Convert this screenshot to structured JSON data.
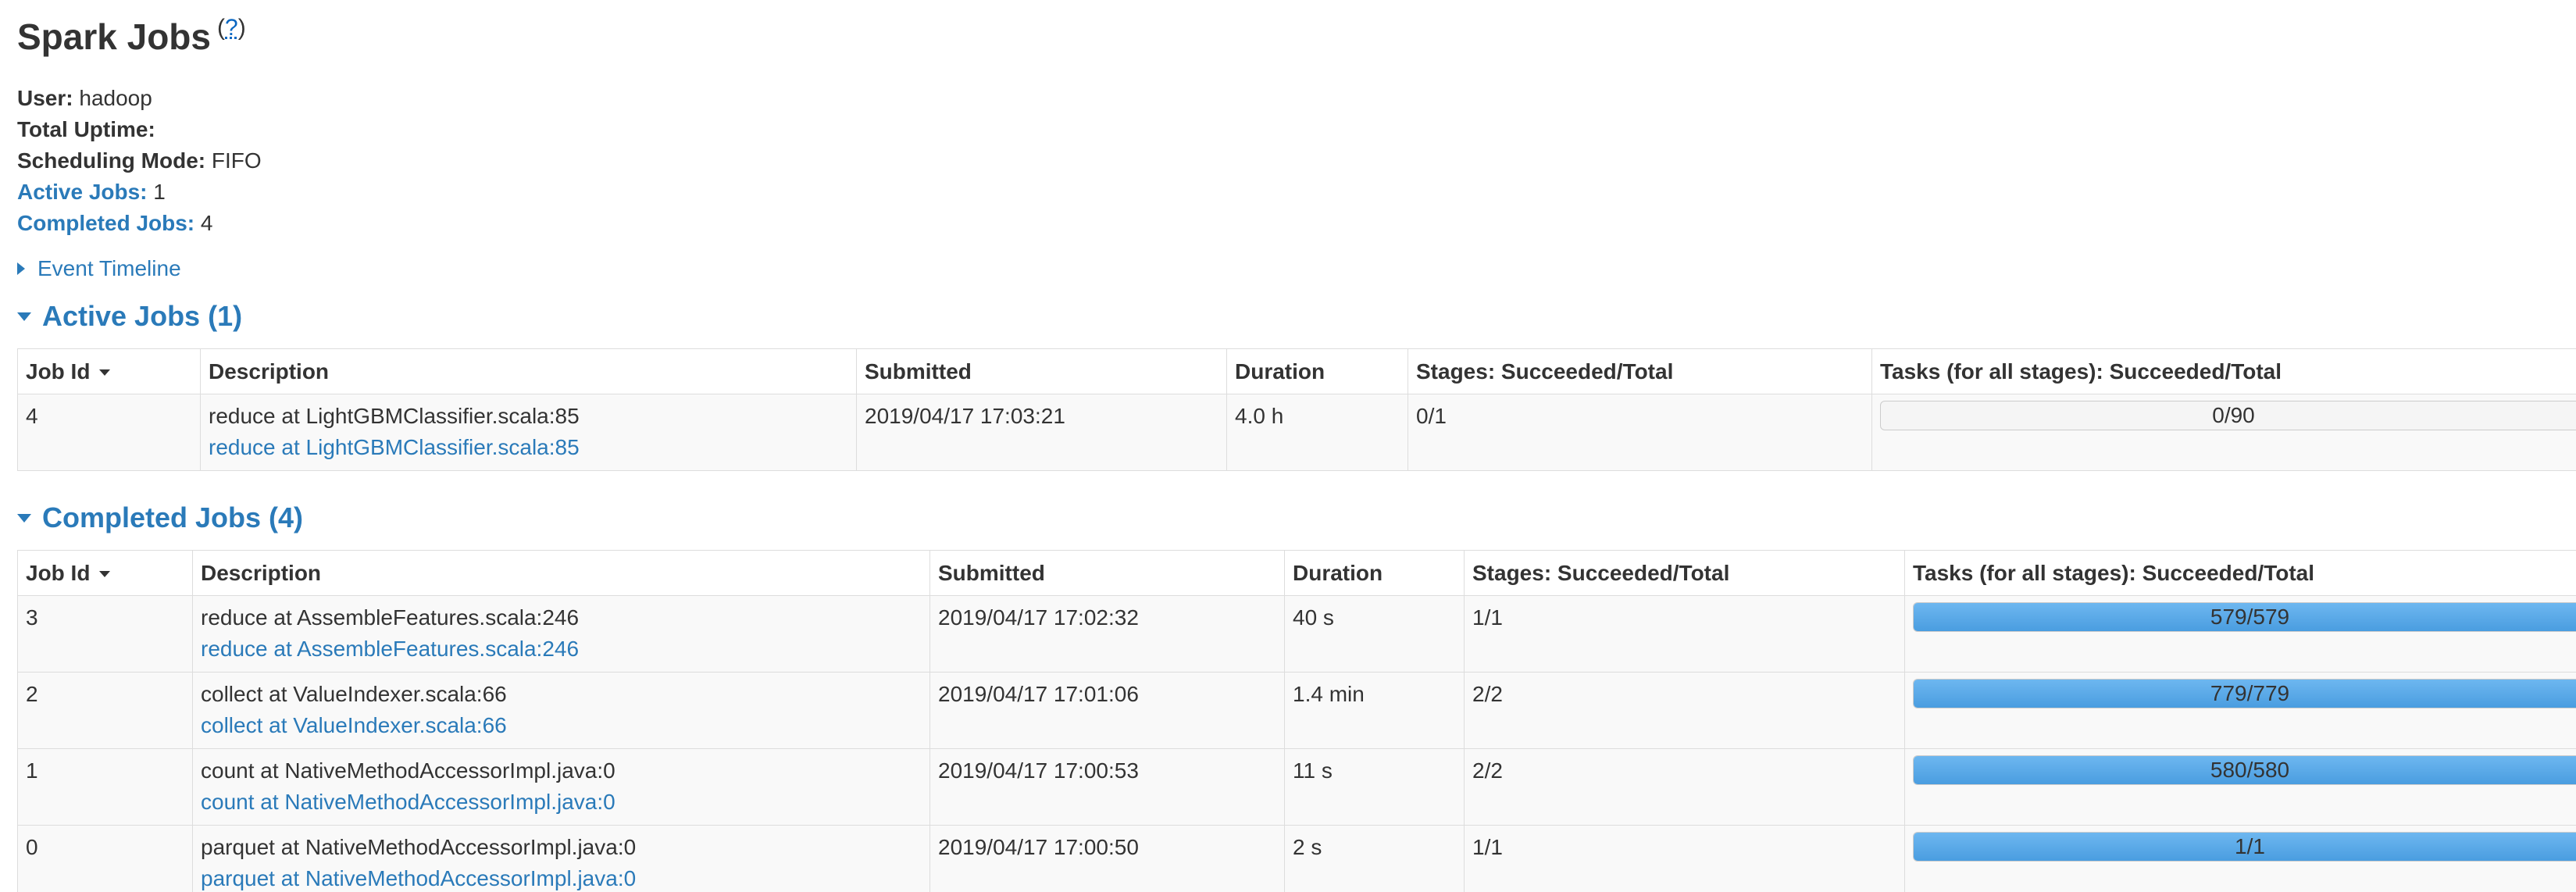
{
  "page": {
    "title": "Spark Jobs",
    "help_open": "(",
    "help_q": "?",
    "help_close": ")"
  },
  "summary": {
    "user_label": "User:",
    "user_value": "hadoop",
    "uptime_label": "Total Uptime:",
    "uptime_value": "",
    "scheduling_label": "Scheduling Mode:",
    "scheduling_value": "FIFO",
    "active_label": "Active Jobs:",
    "active_value": "1",
    "completed_label": "Completed Jobs:",
    "completed_value": "4"
  },
  "timeline": {
    "label": "Event Timeline"
  },
  "columns": {
    "job_id": "Job Id",
    "description": "Description",
    "submitted": "Submitted",
    "duration": "Duration",
    "stages": "Stages: Succeeded/Total",
    "tasks": "Tasks (for all stages): Succeeded/Total"
  },
  "active": {
    "header": "Active Jobs (1)",
    "rows": [
      {
        "id": "4",
        "desc": "reduce at LightGBMClassifier.scala:85",
        "desc_link": "reduce at LightGBMClassifier.scala:85",
        "submitted": "2019/04/17 17:03:21",
        "duration": "4.0 h",
        "stages": "0/1",
        "tasks": "0/90",
        "progress": 0
      }
    ]
  },
  "completed": {
    "header": "Completed Jobs (4)",
    "rows": [
      {
        "id": "3",
        "desc": "reduce at AssembleFeatures.scala:246",
        "desc_link": "reduce at AssembleFeatures.scala:246",
        "submitted": "2019/04/17 17:02:32",
        "duration": "40 s",
        "stages": "1/1",
        "tasks": "579/579",
        "progress": 1
      },
      {
        "id": "2",
        "desc": "collect at ValueIndexer.scala:66",
        "desc_link": "collect at ValueIndexer.scala:66",
        "submitted": "2019/04/17 17:01:06",
        "duration": "1.4 min",
        "stages": "2/2",
        "tasks": "779/779",
        "progress": 1
      },
      {
        "id": "1",
        "desc": "count at NativeMethodAccessorImpl.java:0",
        "desc_link": "count at NativeMethodAccessorImpl.java:0",
        "submitted": "2019/04/17 17:00:53",
        "duration": "11 s",
        "stages": "2/2",
        "tasks": "580/580",
        "progress": 1
      },
      {
        "id": "0",
        "desc": "parquet at NativeMethodAccessorImpl.java:0",
        "desc_link": "parquet at NativeMethodAccessorImpl.java:0",
        "submitted": "2019/04/17 17:00:50",
        "duration": "2 s",
        "stages": "1/1",
        "tasks": "1/1",
        "progress": 1
      }
    ]
  },
  "colors": {
    "link": "#2a7ab9",
    "progress_fill": "#5aaae8"
  }
}
